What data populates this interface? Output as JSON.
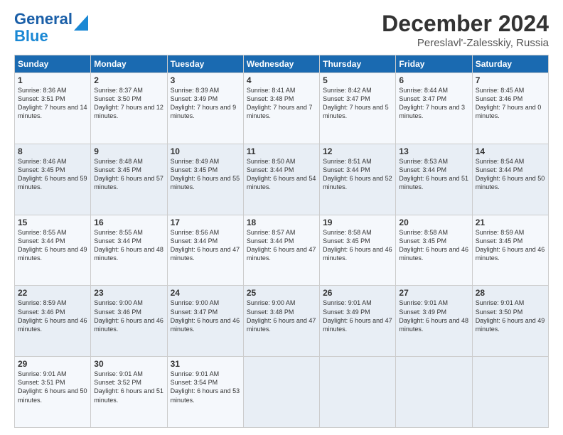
{
  "logo": {
    "line1": "General",
    "line2": "Blue"
  },
  "title": "December 2024",
  "location": "Pereslavl'-Zalesskiy, Russia",
  "days_of_week": [
    "Sunday",
    "Monday",
    "Tuesday",
    "Wednesday",
    "Thursday",
    "Friday",
    "Saturday"
  ],
  "weeks": [
    [
      {
        "day": "1",
        "sunrise": "8:36 AM",
        "sunset": "3:51 PM",
        "daylight": "7 hours and 14 minutes."
      },
      {
        "day": "2",
        "sunrise": "8:37 AM",
        "sunset": "3:50 PM",
        "daylight": "7 hours and 12 minutes."
      },
      {
        "day": "3",
        "sunrise": "8:39 AM",
        "sunset": "3:49 PM",
        "daylight": "7 hours and 9 minutes."
      },
      {
        "day": "4",
        "sunrise": "8:41 AM",
        "sunset": "3:48 PM",
        "daylight": "7 hours and 7 minutes."
      },
      {
        "day": "5",
        "sunrise": "8:42 AM",
        "sunset": "3:47 PM",
        "daylight": "7 hours and 5 minutes."
      },
      {
        "day": "6",
        "sunrise": "8:44 AM",
        "sunset": "3:47 PM",
        "daylight": "7 hours and 3 minutes."
      },
      {
        "day": "7",
        "sunrise": "8:45 AM",
        "sunset": "3:46 PM",
        "daylight": "7 hours and 0 minutes."
      }
    ],
    [
      {
        "day": "8",
        "sunrise": "8:46 AM",
        "sunset": "3:45 PM",
        "daylight": "6 hours and 59 minutes."
      },
      {
        "day": "9",
        "sunrise": "8:48 AM",
        "sunset": "3:45 PM",
        "daylight": "6 hours and 57 minutes."
      },
      {
        "day": "10",
        "sunrise": "8:49 AM",
        "sunset": "3:45 PM",
        "daylight": "6 hours and 55 minutes."
      },
      {
        "day": "11",
        "sunrise": "8:50 AM",
        "sunset": "3:44 PM",
        "daylight": "6 hours and 54 minutes."
      },
      {
        "day": "12",
        "sunrise": "8:51 AM",
        "sunset": "3:44 PM",
        "daylight": "6 hours and 52 minutes."
      },
      {
        "day": "13",
        "sunrise": "8:53 AM",
        "sunset": "3:44 PM",
        "daylight": "6 hours and 51 minutes."
      },
      {
        "day": "14",
        "sunrise": "8:54 AM",
        "sunset": "3:44 PM",
        "daylight": "6 hours and 50 minutes."
      }
    ],
    [
      {
        "day": "15",
        "sunrise": "8:55 AM",
        "sunset": "3:44 PM",
        "daylight": "6 hours and 49 minutes."
      },
      {
        "day": "16",
        "sunrise": "8:55 AM",
        "sunset": "3:44 PM",
        "daylight": "6 hours and 48 minutes."
      },
      {
        "day": "17",
        "sunrise": "8:56 AM",
        "sunset": "3:44 PM",
        "daylight": "6 hours and 47 minutes."
      },
      {
        "day": "18",
        "sunrise": "8:57 AM",
        "sunset": "3:44 PM",
        "daylight": "6 hours and 47 minutes."
      },
      {
        "day": "19",
        "sunrise": "8:58 AM",
        "sunset": "3:45 PM",
        "daylight": "6 hours and 46 minutes."
      },
      {
        "day": "20",
        "sunrise": "8:58 AM",
        "sunset": "3:45 PM",
        "daylight": "6 hours and 46 minutes."
      },
      {
        "day": "21",
        "sunrise": "8:59 AM",
        "sunset": "3:45 PM",
        "daylight": "6 hours and 46 minutes."
      }
    ],
    [
      {
        "day": "22",
        "sunrise": "8:59 AM",
        "sunset": "3:46 PM",
        "daylight": "6 hours and 46 minutes."
      },
      {
        "day": "23",
        "sunrise": "9:00 AM",
        "sunset": "3:46 PM",
        "daylight": "6 hours and 46 minutes."
      },
      {
        "day": "24",
        "sunrise": "9:00 AM",
        "sunset": "3:47 PM",
        "daylight": "6 hours and 46 minutes."
      },
      {
        "day": "25",
        "sunrise": "9:00 AM",
        "sunset": "3:48 PM",
        "daylight": "6 hours and 47 minutes."
      },
      {
        "day": "26",
        "sunrise": "9:01 AM",
        "sunset": "3:49 PM",
        "daylight": "6 hours and 47 minutes."
      },
      {
        "day": "27",
        "sunrise": "9:01 AM",
        "sunset": "3:49 PM",
        "daylight": "6 hours and 48 minutes."
      },
      {
        "day": "28",
        "sunrise": "9:01 AM",
        "sunset": "3:50 PM",
        "daylight": "6 hours and 49 minutes."
      }
    ],
    [
      {
        "day": "29",
        "sunrise": "9:01 AM",
        "sunset": "3:51 PM",
        "daylight": "6 hours and 50 minutes."
      },
      {
        "day": "30",
        "sunrise": "9:01 AM",
        "sunset": "3:52 PM",
        "daylight": "6 hours and 51 minutes."
      },
      {
        "day": "31",
        "sunrise": "9:01 AM",
        "sunset": "3:54 PM",
        "daylight": "6 hours and 53 minutes."
      },
      {
        "day": "",
        "sunrise": "",
        "sunset": "",
        "daylight": ""
      },
      {
        "day": "",
        "sunrise": "",
        "sunset": "",
        "daylight": ""
      },
      {
        "day": "",
        "sunrise": "",
        "sunset": "",
        "daylight": ""
      },
      {
        "day": "",
        "sunrise": "",
        "sunset": "",
        "daylight": ""
      }
    ]
  ]
}
